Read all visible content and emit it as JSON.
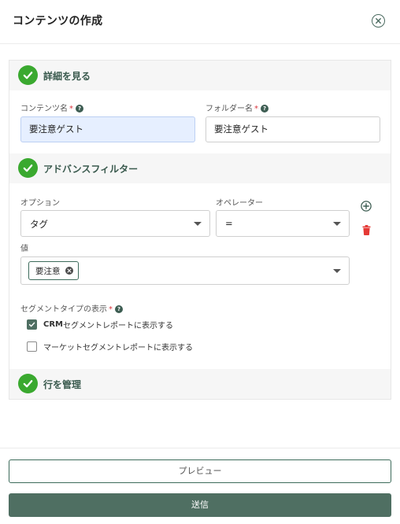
{
  "header": {
    "title": "コンテンツの作成",
    "close_icon": "close-circle-icon"
  },
  "sections": {
    "details": {
      "title": "詳細を見る"
    },
    "advanced_filter": {
      "title": "アドバンスフィルター"
    },
    "manage_rows": {
      "title": "行を管理"
    }
  },
  "details": {
    "content_name": {
      "label": "コンテンツ名",
      "required": "*",
      "help": "?",
      "value": "要注意ゲスト"
    },
    "folder_name": {
      "label": "フォルダー名",
      "required": "*",
      "help": "?",
      "value": "要注意ゲスト"
    }
  },
  "filter": {
    "option": {
      "label": "オプション",
      "value": "タグ"
    },
    "operator": {
      "label": "オペレーター",
      "value": "="
    },
    "value": {
      "label": "値",
      "tag": "要注意"
    },
    "add_icon": "plus-circle-icon",
    "delete_icon": "trash-icon"
  },
  "segment": {
    "label": "セグメントタイプの表示",
    "required": "*",
    "help": "?",
    "options": [
      {
        "prefix": "CRM",
        "label": "セグメントレポートに表示する",
        "checked": true
      },
      {
        "prefix": "",
        "label": "マーケットセグメントレポートに表示する",
        "checked": false
      }
    ]
  },
  "footer": {
    "preview_label": "プレビュー",
    "submit_label": "送信"
  },
  "colors": {
    "accent": "#4f6f62",
    "check_green": "#3aa92f",
    "danger": "#e53935",
    "field_fill": "#e6efff"
  }
}
